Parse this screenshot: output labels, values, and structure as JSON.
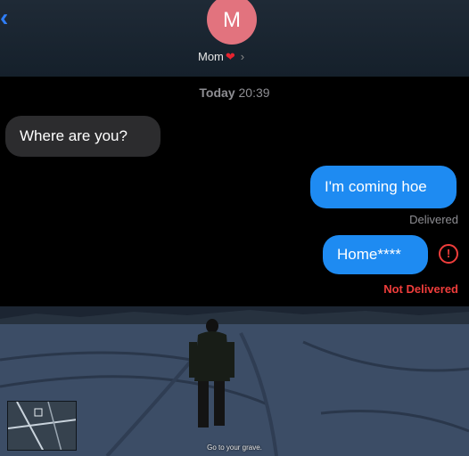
{
  "header": {
    "avatar_letter": "M",
    "contact_name": "Mom",
    "heart": "❤",
    "chevron": "›",
    "back": "‹"
  },
  "conversation": {
    "timestamp_day": "Today",
    "timestamp_time": "20:39",
    "messages": [
      {
        "direction": "incoming",
        "text": "Where are you?"
      },
      {
        "direction": "outgoing",
        "text": "I'm coming hoe",
        "status": "Delivered"
      },
      {
        "direction": "outgoing",
        "text": "Home****",
        "status": "Not Delivered"
      }
    ],
    "error_glyph": "!"
  },
  "game": {
    "caption": "Go to your grave."
  },
  "colors": {
    "bubble_out": "#1e8bf2",
    "bubble_in": "#2c2c2e",
    "error": "#ef3d3b",
    "avatar": "#e2737e"
  }
}
